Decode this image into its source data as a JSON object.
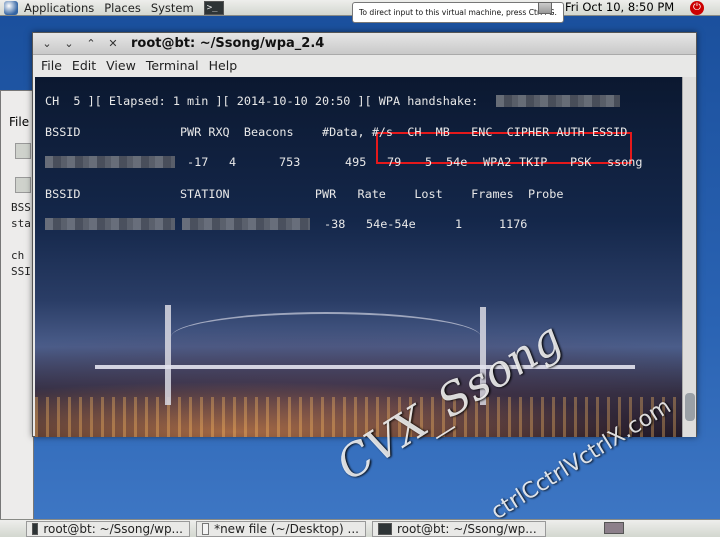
{
  "top_panel": {
    "menus": [
      "Applications",
      "Places",
      "System"
    ],
    "tooltip": "To direct input to this virtual machine, press Ctrl+G.",
    "clock": "Fri Oct 10,  8:50 PM"
  },
  "bg_window": {
    "menu": "File",
    "lines": [
      "BSS",
      "sta",
      "ch",
      "SSI"
    ]
  },
  "terminal": {
    "title": "root@bt: ~/Ssong/wpa_2.4",
    "menu": [
      "File",
      "Edit",
      "View",
      "Terminal",
      "Help"
    ],
    "status_line": "CH  5 ][ Elapsed: 1 min ][ 2014-10-10 20:50 ][ WPA handshake:",
    "ap_header": "BSSID              PWR RXQ  Beacons    #Data, #/s  CH  MB   ENC  CIPHER AUTH ESSID",
    "ap_row": {
      "pwr": "-17",
      "rxq": "4",
      "beacons": "753",
      "data": "495",
      "per_s": "79",
      "ch": "5",
      "mb": "54e",
      "enc": "WPA2",
      "cipher": "TKIP",
      "auth": "PSK",
      "essid": "ssong"
    },
    "sta_header": "BSSID              STATION            PWR   Rate    Lost    Frames  Probe",
    "sta_row": {
      "pwr": "-38",
      "rate": "54e-54e",
      "lost": "1",
      "frames": "1176"
    }
  },
  "watermark": {
    "main": "CVX_Ssong",
    "sub": "ctrlCctrlVctrlX.com"
  },
  "taskbar": {
    "items": [
      "root@bt: ~/Ssong/wp...",
      "*new file (~/Desktop) ...",
      "root@bt: ~/Ssong/wp..."
    ]
  }
}
